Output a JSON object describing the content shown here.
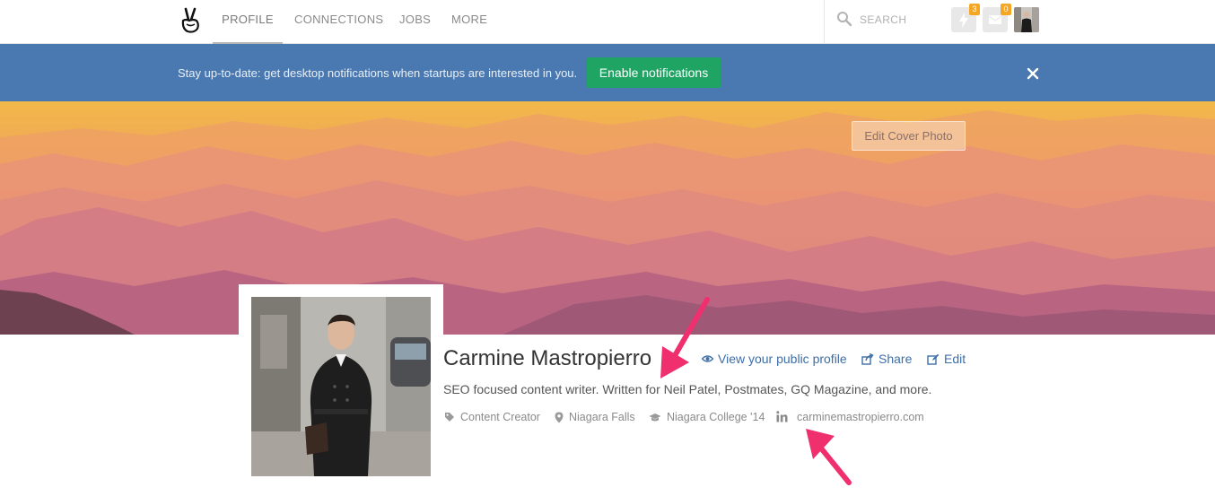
{
  "nav": {
    "tabs": [
      {
        "label": "PROFILE",
        "active": true
      },
      {
        "label": "CONNECTIONS",
        "active": false
      },
      {
        "label": "JOBS",
        "active": false
      },
      {
        "label": "MORE",
        "active": false
      }
    ],
    "search": {
      "placeholder": "SEARCH"
    },
    "buttons": [
      {
        "icon": "lightning-icon",
        "badge": "3"
      },
      {
        "icon": "mail-icon",
        "badge": "0"
      }
    ]
  },
  "banner": {
    "text": "Stay up-to-date: get desktop notifications when startups are interested in you.",
    "button_label": "Enable notifications",
    "close_icon": "close-icon"
  },
  "cover": {
    "edit_label": "Edit Cover Photo"
  },
  "profile": {
    "name": "Carmine Mastropierro",
    "actions": [
      {
        "icon": "eye-icon",
        "label": "View your public profile"
      },
      {
        "icon": "share-icon",
        "label": "Share"
      },
      {
        "icon": "edit-icon",
        "label": "Edit"
      }
    ],
    "bio": "SEO focused content writer. Written for Neil Patel, Postmates, GQ Magazine, and more.",
    "tags": [
      {
        "icon": "tag-icon",
        "label": "Content Creator"
      },
      {
        "icon": "location-pin-icon",
        "label": "Niagara Falls"
      },
      {
        "icon": "graduation-cap-icon",
        "label": "Niagara College '14"
      },
      {
        "icon": "linkedin-icon",
        "label": ""
      },
      {
        "icon": "link-text",
        "label": "carminemastropierro.com"
      }
    ]
  },
  "colors": {
    "banner_bg": "#4a78b0",
    "accent_green": "#1fa463",
    "link_blue": "#3c6ea8",
    "badge_orange": "#f5a623",
    "arrow_pink": "#f0306e"
  }
}
